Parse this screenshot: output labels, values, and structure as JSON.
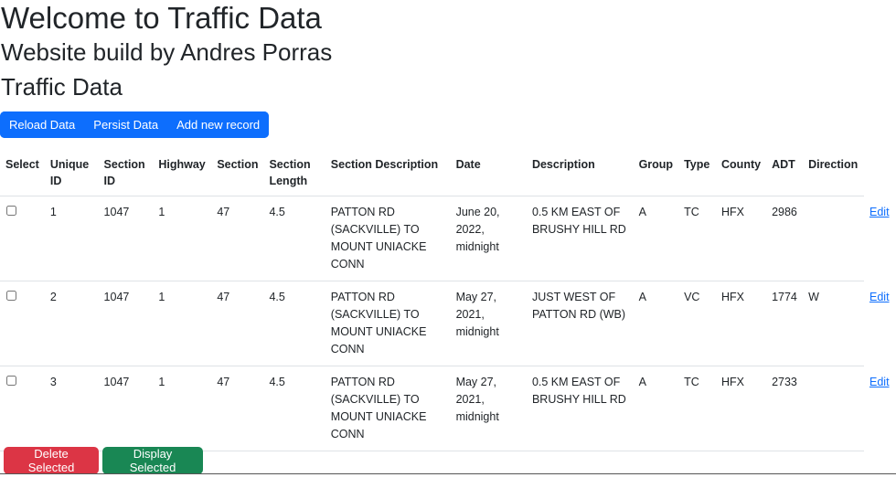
{
  "header": {
    "title": "Welcome to Traffic Data",
    "subtitle": "Website build by Andres Porras",
    "section_title": "Traffic Data"
  },
  "toolbar": {
    "reload_label": "Reload Data",
    "persist_label": "Persist Data",
    "add_label": "Add new record"
  },
  "table": {
    "columns": {
      "select": "Select",
      "unique_id": "Unique ID",
      "section_id": "Section ID",
      "highway": "Highway",
      "section": "Section",
      "section_length": "Section Length",
      "section_description": "Section Description",
      "date": "Date",
      "description": "Description",
      "group": "Group",
      "type": "Type",
      "county": "County",
      "adt": "ADT",
      "direction": "Direction"
    },
    "rows": [
      {
        "unique_id": "1",
        "section_id": "1047",
        "highway": "1",
        "section": "47",
        "section_length": "4.5",
        "section_description": "PATTON RD (SACKVILLE) TO MOUNT UNIACKE CONN",
        "date": "June 20, 2022, midnight",
        "description": "0.5 KM EAST OF BRUSHY HILL RD",
        "group": "A",
        "type": "TC",
        "county": "HFX",
        "adt": "2986",
        "direction": "",
        "edit_label": "Edit"
      },
      {
        "unique_id": "2",
        "section_id": "1047",
        "highway": "1",
        "section": "47",
        "section_length": "4.5",
        "section_description": "PATTON RD (SACKVILLE) TO MOUNT UNIACKE CONN",
        "date": "May 27, 2021, midnight",
        "description": "JUST WEST OF PATTON RD (WB)",
        "group": "A",
        "type": "VC",
        "county": "HFX",
        "adt": "1774",
        "direction": "W",
        "edit_label": "Edit"
      },
      {
        "unique_id": "3",
        "section_id": "1047",
        "highway": "1",
        "section": "47",
        "section_length": "4.5",
        "section_description": "PATTON RD (SACKVILLE) TO MOUNT UNIACKE CONN",
        "date": "May 27, 2021, midnight",
        "description": "0.5 KM EAST OF BRUSHY HILL RD",
        "group": "A",
        "type": "TC",
        "county": "HFX",
        "adt": "2733",
        "direction": "",
        "edit_label": "Edit"
      }
    ]
  },
  "actions": {
    "delete_label": "Delete Selected",
    "display_label": "Display Selected"
  },
  "colors": {
    "primary": "#0d6efd",
    "danger": "#dc3545",
    "success": "#198754"
  }
}
